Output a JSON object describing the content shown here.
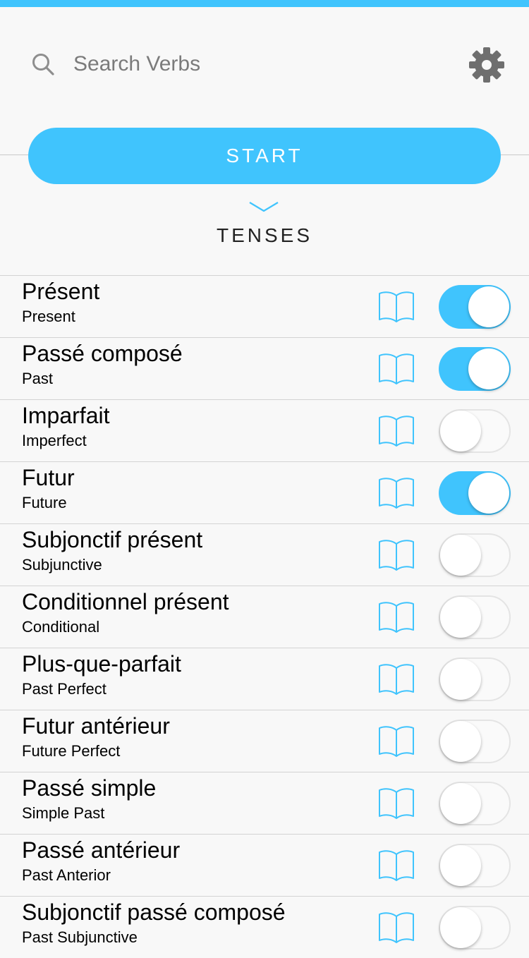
{
  "search": {
    "placeholder": "Search Verbs"
  },
  "start_label": "START",
  "section_title": "TENSES",
  "colors": {
    "accent": "#40c4fd",
    "background": "#f8f8f8",
    "toggle_off_border": "#e4e4e4"
  },
  "icons": {
    "search": "search-icon",
    "settings": "gear-icon",
    "expand": "chevron-down-icon",
    "reference": "book-icon"
  },
  "tenses": [
    {
      "title": "Présent",
      "subtitle": "Present",
      "enabled": true
    },
    {
      "title": "Passé composé",
      "subtitle": "Past",
      "enabled": true
    },
    {
      "title": "Imparfait",
      "subtitle": "Imperfect",
      "enabled": false
    },
    {
      "title": "Futur",
      "subtitle": "Future",
      "enabled": true
    },
    {
      "title": "Subjonctif présent",
      "subtitle": "Subjunctive",
      "enabled": false
    },
    {
      "title": "Conditionnel présent",
      "subtitle": "Conditional",
      "enabled": false
    },
    {
      "title": "Plus-que-parfait",
      "subtitle": "Past Perfect",
      "enabled": false
    },
    {
      "title": "Futur antérieur",
      "subtitle": "Future Perfect",
      "enabled": false
    },
    {
      "title": "Passé simple",
      "subtitle": "Simple Past",
      "enabled": false
    },
    {
      "title": "Passé antérieur",
      "subtitle": "Past Anterior",
      "enabled": false
    },
    {
      "title": "Subjonctif passé composé",
      "subtitle": "Past Subjunctive",
      "enabled": false
    }
  ]
}
